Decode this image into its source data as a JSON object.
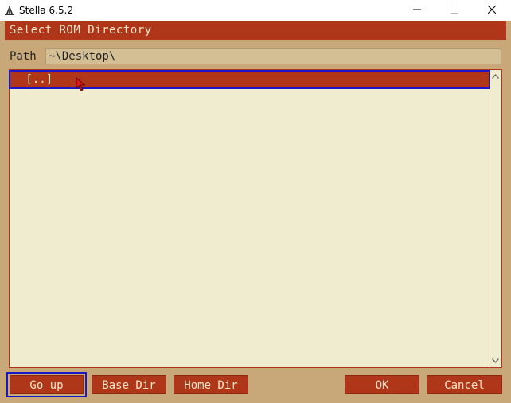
{
  "window": {
    "title": "Stella 6.5.2",
    "icon": "stella-app-icon",
    "controls": [
      "minimize-icon",
      "maximize-icon",
      "close-icon"
    ]
  },
  "dialog": {
    "title": "Select ROM Directory",
    "path_label": "Path",
    "path_value": "~\\Desktop\\"
  },
  "file_list": {
    "items": [
      {
        "label": " [..]",
        "selected": true
      }
    ]
  },
  "buttons": {
    "go_up": "Go up",
    "base_dir": "Base Dir",
    "home_dir": "Home Dir",
    "ok": "OK",
    "cancel": "Cancel"
  },
  "colors": {
    "accent": "#b0361a",
    "background": "#c8a878",
    "list_background": "#f0ecd0",
    "text_light": "#f0e8c8",
    "focus_outline": "#1818c8"
  }
}
